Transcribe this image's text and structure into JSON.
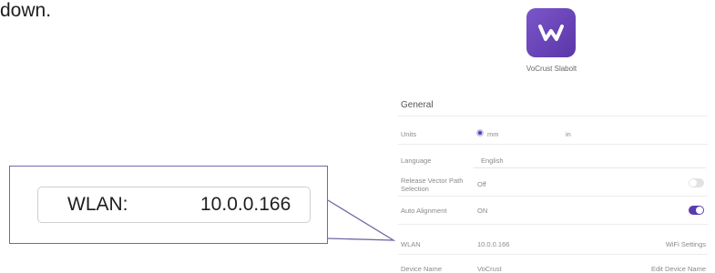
{
  "doc_text": {
    "top_fragment": "down."
  },
  "callout": {
    "label": "WLAN:",
    "value": "10.0.0.166"
  },
  "app": {
    "name": "VoCrust Slabolt",
    "accent_color": "#5b36a8",
    "logo_icon": "app-logo-icon"
  },
  "general": {
    "title": "General",
    "units": {
      "label": "Units",
      "option_selected": "mm",
      "option_other": "in"
    },
    "language": {
      "label": "Language",
      "value": "English"
    },
    "flat_detect": {
      "label_line1": "Release Vector Path",
      "label_line2": "Selection",
      "value": "Off",
      "toggle_on": false
    },
    "auto_alignment": {
      "label": "Auto Alignment",
      "value": "ON",
      "toggle_on": true
    },
    "wlan": {
      "label": "WLAN",
      "value": "10.0.0.166",
      "link": "WiFi Settings"
    },
    "device_name": {
      "label": "Device Name",
      "value": "VoCrust",
      "link": "Edit Device Name"
    }
  }
}
